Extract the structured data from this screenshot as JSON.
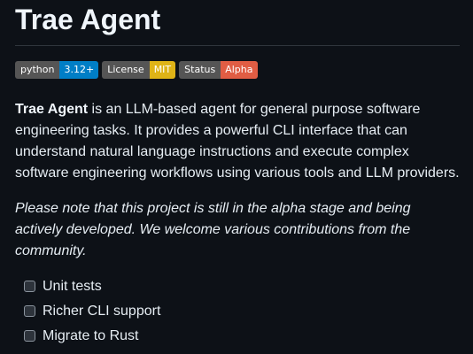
{
  "title": "Trae Agent",
  "badges": [
    {
      "label": "python",
      "value": "3.12+",
      "color": "#007ec6"
    },
    {
      "label": "License",
      "value": "MIT",
      "color": "#dfb317"
    },
    {
      "label": "Status",
      "value": "Alpha",
      "color": "#e05d44"
    }
  ],
  "intro": {
    "bold": "Trae Agent",
    "text": " is an LLM-based agent for general purpose software engineering tasks. It provides a powerful CLI interface that can understand natural language instructions and execute complex software engineering workflows using various tools and LLM providers."
  },
  "note": "Please note that this project is still in the alpha stage and being actively developed. We welcome various contributions from the community.",
  "tasks": [
    {
      "label": "Unit tests",
      "checked": false
    },
    {
      "label": "Richer CLI support",
      "checked": false
    },
    {
      "label": "Migrate to Rust",
      "checked": false
    }
  ]
}
